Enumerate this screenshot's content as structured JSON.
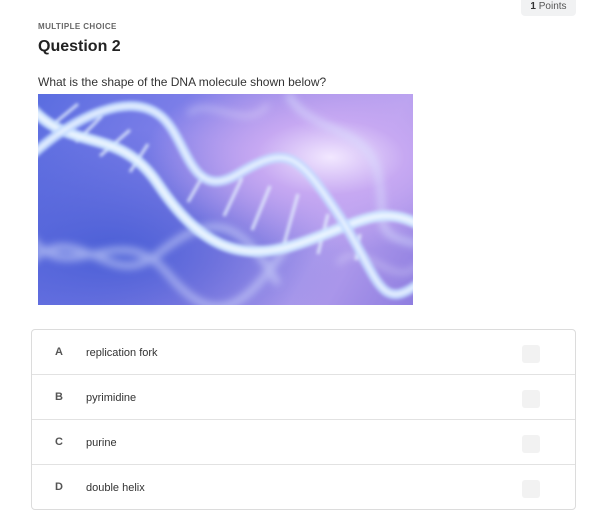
{
  "header": {
    "points_count": "1",
    "points_label": "Points",
    "question_type": "MULTIPLE CHOICE",
    "question_title": "Question 2",
    "prompt": "What is the shape of the DNA molecule shown below?"
  },
  "image": {
    "subject": "dna-double-helix",
    "colors": {
      "background": "#7c7ee8",
      "highlight": "#f2e8ff",
      "helix": "#cfe6ff"
    }
  },
  "answers": [
    {
      "letter": "A",
      "text": "replication fork"
    },
    {
      "letter": "B",
      "text": "pyrimidine"
    },
    {
      "letter": "C",
      "text": "purine"
    },
    {
      "letter": "D",
      "text": "double helix"
    }
  ]
}
